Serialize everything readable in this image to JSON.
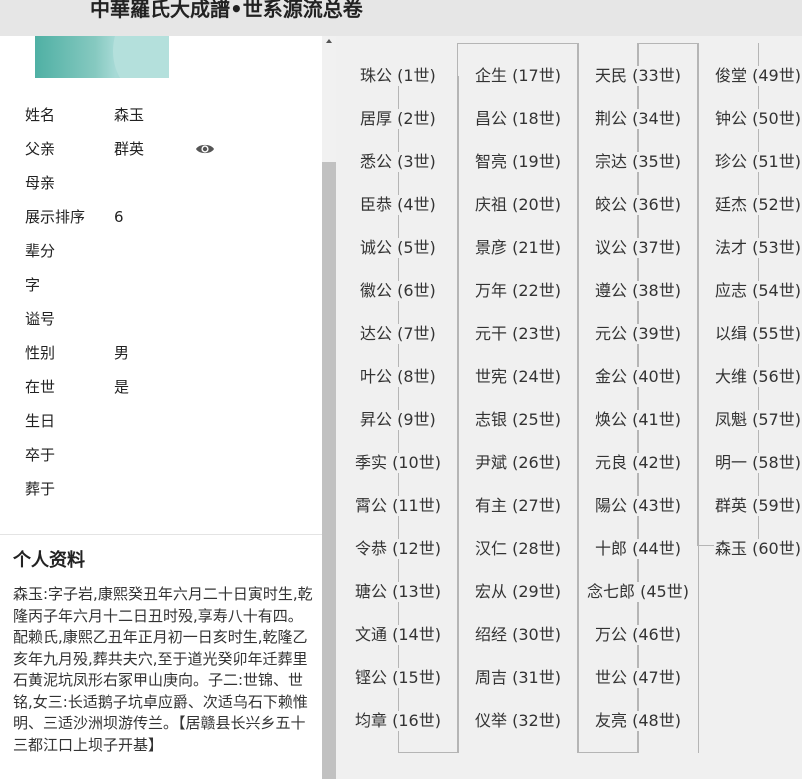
{
  "header": {
    "title": "中華羅氏大成譜•世系源流总卷"
  },
  "person": {
    "fields": [
      {
        "label": "姓名",
        "value": "森玉"
      },
      {
        "label": "父亲",
        "value": "群英"
      },
      {
        "label": "母亲",
        "value": ""
      },
      {
        "label": "展示排序",
        "value": "6"
      },
      {
        "label": "辈分",
        "value": ""
      },
      {
        "label": "字",
        "value": ""
      },
      {
        "label": "谥号",
        "value": ""
      },
      {
        "label": "性别",
        "value": "男"
      },
      {
        "label": "在世",
        "value": "是"
      },
      {
        "label": "生日",
        "value": ""
      },
      {
        "label": "卒于",
        "value": ""
      },
      {
        "label": "葬于",
        "value": ""
      }
    ],
    "father_view_icon": "eye-icon"
  },
  "profile": {
    "title": "个人资料",
    "text": "森玉:字子岩,康熙癸丑年六月二十日寅时生,乾隆丙子年六月十二日丑时殁,享寿八十有四。配赖氏,康熙乙丑年正月初一日亥时生,乾隆乙亥年九月殁,葬共夫穴,至于道光癸卯年迁葬里石黄泥坑凤形右冢甲山庚向。子二:世锦、世铭,女三:长适鹅子坑卓应爵、次适乌石下赖惟明、三适沙洲坝游传兰。【居赣县长兴乡五十三都江口上坝子开基】"
  },
  "lineage": {
    "columns": [
      [
        "珠公 (1世)",
        "居厚 (2世)",
        "悉公 (3世)",
        "臣恭 (4世)",
        "诚公 (5世)",
        "徽公 (6世)",
        "达公 (7世)",
        "叶公 (8世)",
        "昇公 (9世)",
        "季实 (10世)",
        "霄公 (11世)",
        "令恭 (12世)",
        "瑭公 (13世)",
        "文通 (14世)",
        "铿公 (15世)",
        "均章 (16世)"
      ],
      [
        "企生 (17世)",
        "昌公 (18世)",
        "智亮 (19世)",
        "庆祖 (20世)",
        "景彦 (21世)",
        "万年 (22世)",
        "元干 (23世)",
        "世宪 (24世)",
        "志银 (25世)",
        "尹斌 (26世)",
        "有主 (27世)",
        "汉仁 (28世)",
        "宏从 (29世)",
        "绍经 (30世)",
        "周吉 (31世)",
        "仪举 (32世)"
      ],
      [
        "天民 (33世)",
        "荆公 (34世)",
        "宗达 (35世)",
        "皎公 (36世)",
        "议公 (37世)",
        "遵公 (38世)",
        "元公 (39世)",
        "金公 (40世)",
        "焕公 (41世)",
        "元良 (42世)",
        "陽公 (43世)",
        "十郎 (44世)",
        "念七郎 (45世)",
        "万公 (46世)",
        "世公 (47世)",
        "友亮 (48世)"
      ],
      [
        "俊堂 (49世)",
        "钟公 (50世)",
        "珍公 (51世)",
        "廷杰 (52世)",
        "法才 (53世)",
        "应志 (54世)",
        "以缉 (55世)",
        "大维 (56世)",
        "凤魁 (57世)",
        "明一 (58世)",
        "群英 (59世)",
        "森玉 (60世)"
      ]
    ]
  }
}
